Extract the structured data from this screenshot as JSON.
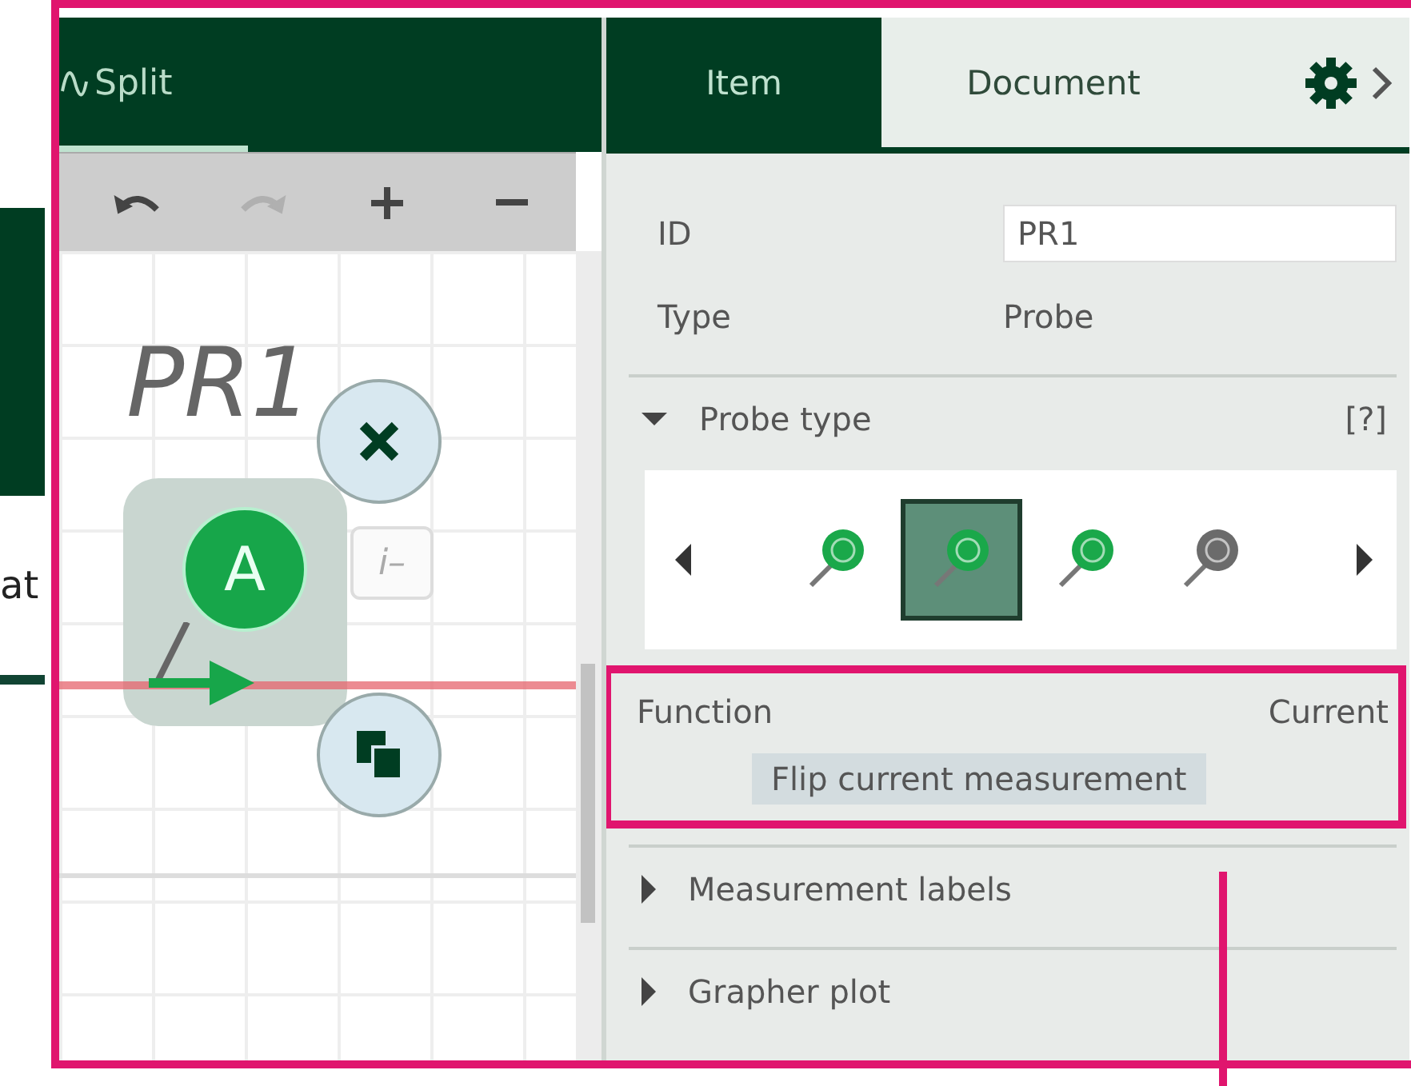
{
  "window": {
    "highlighted": true
  },
  "outside": {
    "text": "at"
  },
  "left_pane": {
    "tabs": [
      {
        "label": "Split",
        "selected": true
      }
    ],
    "toolbar": [
      {
        "kind": "undo",
        "disabled": false
      },
      {
        "kind": "redo",
        "disabled": true
      },
      {
        "kind": "zoom-in",
        "disabled": false
      },
      {
        "kind": "zoom-out",
        "disabled": false
      }
    ],
    "canvas": {
      "label": "PR1",
      "probe_letter": "A",
      "info_button": "i–"
    }
  },
  "right_panel": {
    "tabs": [
      {
        "label": "Item",
        "selected": true
      },
      {
        "label": "Document",
        "selected": false
      }
    ],
    "properties": [
      {
        "kind": "field",
        "label": "ID",
        "value": "PR1"
      },
      {
        "kind": "text",
        "label": "Type",
        "value": "Probe"
      }
    ],
    "sections": [
      {
        "kind": "picker",
        "title": "Probe type",
        "expanded": true,
        "help": "[?]",
        "options": [
          {
            "color": "#1aa84a",
            "selected": false
          },
          {
            "color": "#1aa84a",
            "selected": true
          },
          {
            "color": "#1aa84a",
            "selected": false
          },
          {
            "color": "#6b6b6b",
            "selected": false
          }
        ]
      },
      {
        "kind": "function",
        "highlighted": true,
        "label": "Function",
        "value": "Current",
        "button": "Flip current measurement"
      },
      {
        "kind": "collapsible",
        "title": "Measurement labels",
        "expanded": false
      },
      {
        "kind": "collapsible",
        "title": "Grapher plot",
        "expanded": false
      }
    ]
  }
}
